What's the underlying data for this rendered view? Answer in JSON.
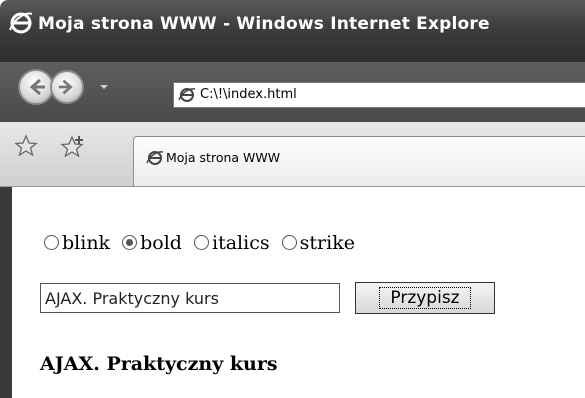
{
  "window": {
    "title": "Moja strona WWW - Windows Internet Explore"
  },
  "nav": {
    "address": "C:\\!\\index.html"
  },
  "tabs": [
    {
      "label": "Moja strona WWW"
    }
  ],
  "form": {
    "radios": [
      {
        "label": "blink",
        "checked": false
      },
      {
        "label": "bold",
        "checked": true
      },
      {
        "label": "italics",
        "checked": false
      },
      {
        "label": "strike",
        "checked": false
      }
    ],
    "input_value": "AJAX. Praktyczny kurs",
    "button_label": "Przypisz",
    "result_text": "AJAX. Praktyczny kurs"
  }
}
